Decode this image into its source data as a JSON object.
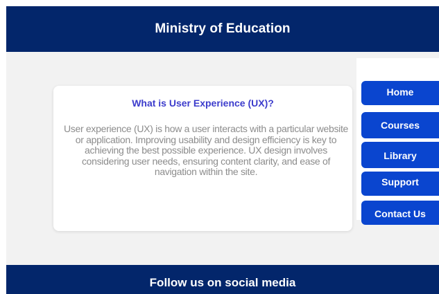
{
  "header": {
    "title": "Ministry of Education",
    "background_color": "#03266b"
  },
  "card": {
    "title": "What is User Experience (UX)?",
    "body": "User experience (UX) is how a user interacts with a particular website or application. Improving usability and design efficiency is key to achieving the best possible experience. UX design involves considering user needs, ensuring content clarity, and ease of navigation within the site.",
    "title_color": "#3c3ccc",
    "text_color": "#8c8c8c"
  },
  "nav": {
    "button_color": "#0a45cf",
    "items": [
      {
        "label": "Home"
      },
      {
        "label": "Courses"
      },
      {
        "label": "Library"
      },
      {
        "label": "Support"
      },
      {
        "label": "Contact Us"
      }
    ]
  },
  "footer": {
    "text": "Follow us on social media"
  }
}
